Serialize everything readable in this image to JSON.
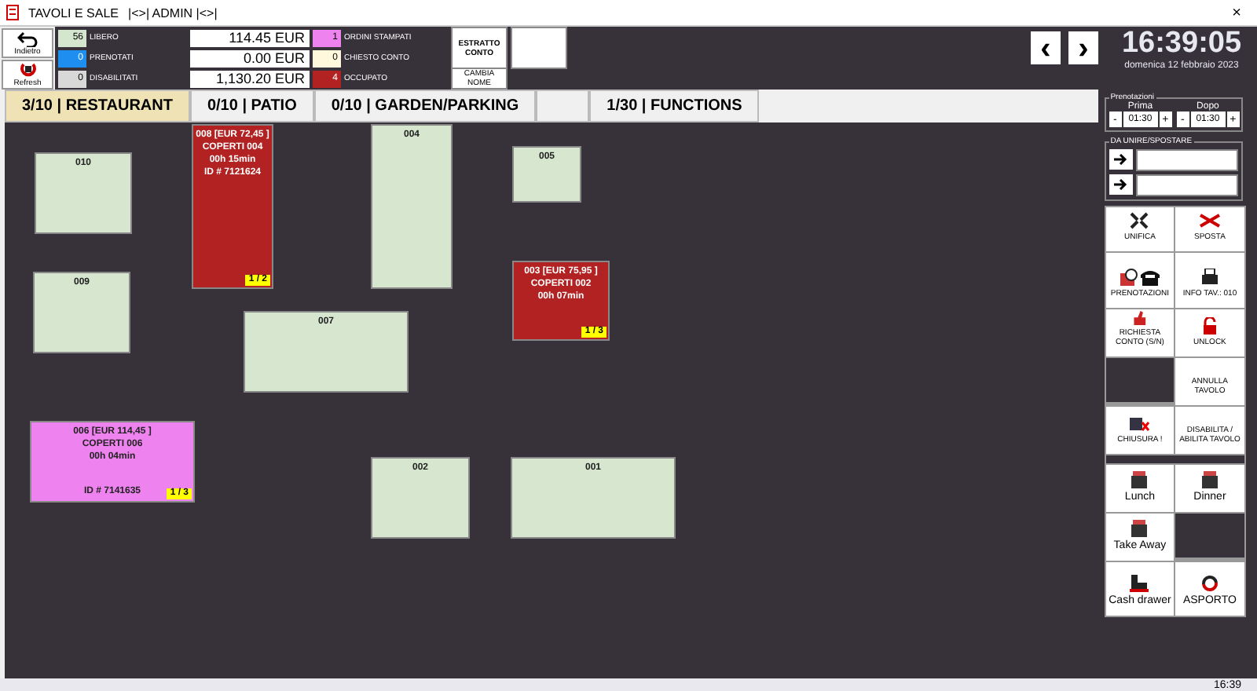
{
  "window": {
    "title": "TAVOLI E SALE",
    "subtitle": "|<>| ADMIN |<>|",
    "close": "×"
  },
  "nav_buttons": [
    {
      "label": "Indietro",
      "kind": "back"
    },
    {
      "label": "Refresh",
      "kind": "refresh"
    }
  ],
  "stats": [
    {
      "count": "56",
      "label": "LIBERO",
      "color": "#d5e6cf"
    },
    {
      "count": "0",
      "label": "PRENOTATI",
      "color": "#1e8ff0"
    },
    {
      "count": "0",
      "label": "DISABILITATI",
      "color": "#d8d8d8"
    }
  ],
  "amounts": [
    "114.45 EUR",
    "0.00 EUR",
    "1,130.20 EUR"
  ],
  "stats_2": [
    {
      "count": "1",
      "label": "ORDINI STAMPATI",
      "color": "#ee82ee"
    },
    {
      "count": "0",
      "label": "CHIESTO CONTO",
      "color": "#fff8dc"
    },
    {
      "count": "4",
      "label": "OCCUPATO",
      "color": "#b22222"
    }
  ],
  "estratto_conto": "ESTRATTO CONTO",
  "cambia_nome": "CAMBIA NOME",
  "arrows": [
    "‹",
    "›"
  ],
  "clock": {
    "time": "16:39:05",
    "date": "domenica 12 febbraio 2023"
  },
  "tabs": [
    {
      "label": "3/10 | RESTAURANT",
      "selected": true
    },
    {
      "label": "0/10 | PATIO",
      "selected": false
    },
    {
      "label": "0/10 | GARDEN/PARKING",
      "selected": false
    },
    {
      "selected": false
    },
    {
      "label": "1/30 | FUNCTIONS",
      "selected": false
    }
  ],
  "tables": [
    {
      "color": "#d6e6cf",
      "lines": [
        "010"
      ]
    },
    {
      "color": "#b22222",
      "lines": [
        "008   [EUR 72,45 ]",
        "COPERTI 004",
        "00h 15min"
      ],
      "id": "ID # 7121624",
      "badge": "1 / 2"
    },
    {
      "color": "#d6e6cf",
      "lines": [
        "004"
      ]
    },
    {
      "color": "#d6e6cf",
      "lines": [
        "005"
      ]
    },
    {
      "color": "#d6e6cf",
      "lines": [
        "009"
      ]
    },
    {
      "color": "#b22222",
      "lines": [
        "003   [EUR 75,95 ]",
        "COPERTI 002",
        "00h 07min"
      ],
      "badge": "1 / 3"
    },
    {
      "color": "#d6e6cf",
      "lines": [
        "007"
      ]
    },
    {
      "color": "#ee82ee",
      "lines": [
        "006   [EUR 114,45 ]",
        "COPERTI 006",
        "00h 04min"
      ],
      "id": "ID # 7141635",
      "badge": "1 / 3"
    },
    {
      "color": "#d6e6cf",
      "lines": [
        "002"
      ]
    },
    {
      "color": "#d6e6cf",
      "lines": [
        "001"
      ]
    }
  ],
  "prenotazioni": {
    "title": "Prenotazioni",
    "fields": [
      {
        "label": "Prima",
        "minus": "-",
        "value": "01:30",
        "plus": "+"
      },
      {
        "label": "Dopo",
        "minus": "-",
        "value": "01:30",
        "plus": "+"
      }
    ]
  },
  "unire": {
    "title": "DA UNIRE/SPOSTARE"
  },
  "action_rows": [
    {
      "kind": "buttons",
      "cells": [
        {
          "kind": "merge",
          "label": "UNIFICA"
        },
        {
          "kind": "move",
          "label": "SPOSTA"
        }
      ]
    },
    {
      "kind": "buttons",
      "cells": [
        {
          "kind": "booking",
          "label": "PRENOTAZIONI"
        },
        {
          "kind": "info",
          "label": "INFO  TAV.: 010"
        }
      ]
    },
    {
      "kind": "buttons",
      "cells": [
        {
          "kind": "bill",
          "label": "RICHIESTA CONTO (S/N)"
        },
        {
          "kind": "unlock",
          "label": "UNLOCK"
        }
      ]
    },
    {
      "kind": "buttons",
      "cells": [
        {
          "kind": "empty"
        },
        {
          "kind": "plain",
          "label": "ANNULLA TAVOLO"
        }
      ]
    },
    {
      "kind": "buttons",
      "cells": [
        {
          "kind": "close",
          "label": "CHIUSURA !"
        },
        {
          "kind": "plain",
          "label": "DISABILITA / ABILITA TAVOLO"
        }
      ]
    },
    {
      "kind": "gap"
    },
    {
      "kind": "buttons",
      "cells": [
        {
          "kind": "register",
          "label": "Lunch"
        },
        {
          "kind": "register",
          "label": "Dinner"
        }
      ]
    },
    {
      "kind": "buttons",
      "cells": [
        {
          "kind": "register",
          "label": "Take Away"
        },
        {
          "kind": "empty"
        }
      ]
    },
    {
      "kind": "buttons",
      "cells": [
        {
          "kind": "drawer",
          "label": "Cash drawer"
        },
        {
          "kind": "takeaway",
          "label": "ASPORTO"
        }
      ]
    }
  ],
  "taskbar": {
    "time": "16:39"
  }
}
